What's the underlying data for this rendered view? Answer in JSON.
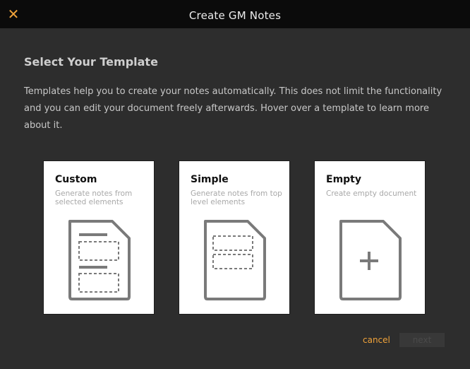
{
  "window": {
    "title": "Create GM Notes",
    "close_icon": "close-icon"
  },
  "heading": "Select Your Template",
  "description": "Templates help you to create your notes automatically. This does not limit the functionality and you can edit your document freely afterwards. Hover over a template to learn more about it.",
  "templates": [
    {
      "title": "Custom",
      "description": "Generate notes from selected elements",
      "icon": "custom-template-icon"
    },
    {
      "title": "Simple",
      "description": "Generate notes from top level elements",
      "icon": "simple-template-icon"
    },
    {
      "title": "Empty",
      "description": "Create empty document",
      "icon": "empty-document-icon"
    }
  ],
  "footer": {
    "cancel_label": "cancel",
    "next_label": "next"
  },
  "colors": {
    "accent": "#f0a33a",
    "titlebar": "#0b0b0b",
    "background": "#2d2d2d",
    "card": "#ffffff",
    "icon_stroke": "#7a7a7a"
  }
}
